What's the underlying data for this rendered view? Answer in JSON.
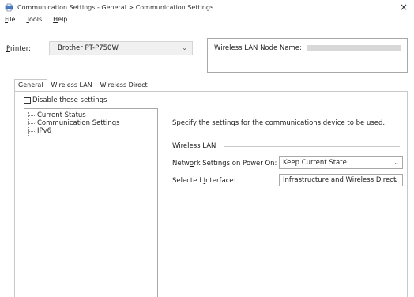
{
  "window": {
    "title": "Communication Settings - General > Communication Settings",
    "close_glyph": "×",
    "app_icon": "printer-app-icon"
  },
  "menu": [
    {
      "accel": "F",
      "rest": "ile"
    },
    {
      "accel": "T",
      "rest": "ools"
    },
    {
      "accel": "H",
      "rest": "elp"
    }
  ],
  "printer": {
    "label_accel": "P",
    "label_rest": "rinter:",
    "selected": "Brother PT-P750W",
    "arrow": "⌄"
  },
  "node": {
    "label": "Wireless LAN Node Name:"
  },
  "tabs": [
    {
      "label": "General",
      "active": true
    },
    {
      "label": "Wireless LAN",
      "active": false
    },
    {
      "label": "Wireless Direct",
      "active": false
    }
  ],
  "disable": {
    "label_pre": "Disa",
    "label_accel": "b",
    "label_post": "le these settings",
    "checked": false
  },
  "tree": [
    "Current Status",
    "Communication Settings",
    "IPv6"
  ],
  "content": {
    "description": "Specify the settings for the communications device to be used.",
    "group": "Wireless LAN",
    "network_label_pre": "Netw",
    "network_label_accel": "o",
    "network_label_post": "rk Settings on Power On:",
    "network_value": "Keep Current State",
    "interface_label_pre": "Selected ",
    "interface_label_accel": "I",
    "interface_label_post": "nterface:",
    "interface_value": "Infrastructure and Wireless Direct",
    "arrow": "⌄"
  }
}
